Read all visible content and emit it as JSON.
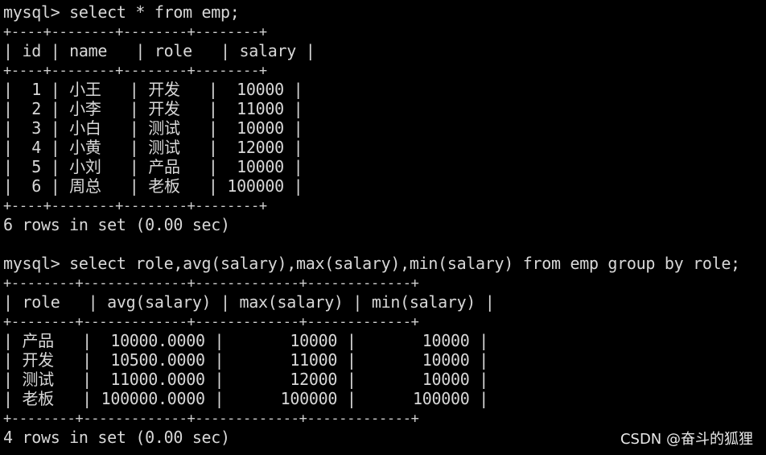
{
  "terminal": {
    "lines": [
      "mysql> select * from emp;",
      "+----+--------+--------+--------+",
      "| id | name   | role   | salary |",
      "+----+--------+--------+--------+",
      "|  1 | 小王   | 开发   |  10000 |",
      "|  2 | 小李   | 开发   |  11000 |",
      "|  3 | 小白   | 测试   |  10000 |",
      "|  4 | 小黄   | 测试   |  12000 |",
      "|  5 | 小刘   | 产品   |  10000 |",
      "|  6 | 周总   | 老板   | 100000 |",
      "+----+--------+--------+--------+",
      "6 rows in set (0.00 sec)",
      "",
      "mysql> select role,avg(salary),max(salary),min(salary) from emp group by role;",
      "+--------+-------------+-------------+-------------+",
      "| role   | avg(salary) | max(salary) | min(salary) |",
      "+--------+-------------+-------------+-------------+",
      "| 产品   |  10000.0000 |       10000 |       10000 |",
      "| 开发   |  10500.0000 |       11000 |       10000 |",
      "| 测试   |  11000.0000 |       12000 |       10000 |",
      "| 老板   | 100000.0000 |      100000 |      100000 |",
      "+--------+-------------+-------------+-------------+",
      "4 rows in set (0.00 sec)"
    ]
  },
  "watermark": "CSDN @奋斗的狐狸",
  "colors": {
    "background": "#000000",
    "text": "#d8d8d8"
  }
}
